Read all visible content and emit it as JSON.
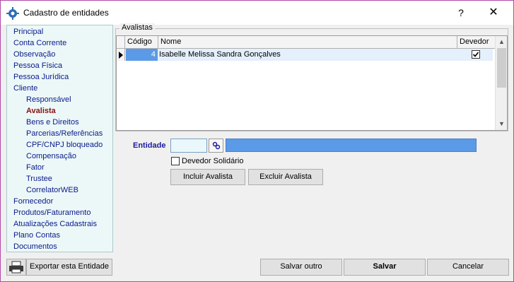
{
  "window": {
    "title": "Cadastro de entidades",
    "help_label": "?",
    "close_label": "✕"
  },
  "sidebar": {
    "items": [
      {
        "label": "Principal"
      },
      {
        "label": "Conta Corrente"
      },
      {
        "label": "Observação"
      },
      {
        "label": "Pessoa Física"
      },
      {
        "label": "Pessoa Jurídica"
      },
      {
        "label": "Cliente"
      },
      {
        "label": "Responsável"
      },
      {
        "label": "Avalista"
      },
      {
        "label": "Bens e Direitos"
      },
      {
        "label": "Parcerias/Referências"
      },
      {
        "label": "CPF/CNPJ bloqueado"
      },
      {
        "label": "Compensação"
      },
      {
        "label": "Fator"
      },
      {
        "label": "Trustee"
      },
      {
        "label": "CorrelatorWEB"
      },
      {
        "label": "Fornecedor"
      },
      {
        "label": "Produtos/Faturamento"
      },
      {
        "label": "Atualizações Cadastrais"
      },
      {
        "label": "Plano Contas"
      },
      {
        "label": "Documentos"
      }
    ]
  },
  "avalistas": {
    "group_label": "Avalistas",
    "columns": [
      "Código",
      "Nome",
      "Devedor"
    ],
    "rows": [
      {
        "codigo": "4",
        "nome": "Isabelle Melissa Sandra Gonçalves",
        "devedor": true
      }
    ]
  },
  "entidade": {
    "label": "Entidade",
    "code_value": "",
    "description_value": ""
  },
  "devedor_solidario": {
    "label": "Devedor Solidário",
    "checked": false
  },
  "buttons": {
    "incluir": "Incluir Avalista",
    "excluir": "Excluir Avalista",
    "exportar": "Exportar esta Entidade",
    "salvar_outro": "Salvar outro",
    "salvar": "Salvar",
    "cancelar": "Cancelar"
  },
  "colors": {
    "accent_blue": "#5b9ae6",
    "active_item": "#8b1010",
    "nav_link": "#0a1a8a",
    "window_border": "#b24aa8"
  }
}
